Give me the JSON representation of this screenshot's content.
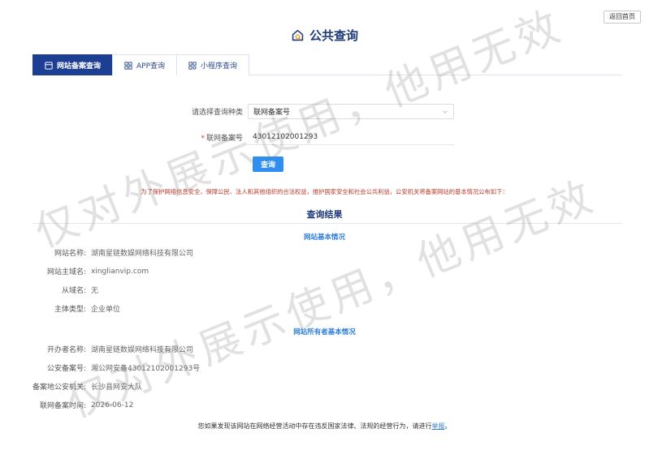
{
  "header": {
    "back_home": "返回首页",
    "title": "公共查询",
    "title_icon": "house-search-icon"
  },
  "tabs": [
    {
      "label": "网站备案查询",
      "icon": "globe-icon",
      "active": true
    },
    {
      "label": "APP查询",
      "icon": "app-grid-icon",
      "active": false
    },
    {
      "label": "小程序查询",
      "icon": "mini-program-icon",
      "active": false
    }
  ],
  "form": {
    "type_label": "请选择查询种类",
    "type_value": "联网备案号",
    "number_label": "联网备案号",
    "number_required_mark": "*",
    "number_value": "43012102001293",
    "query_button": "查询"
  },
  "notice": "为了保护网络信息安全，保障公民、法人和其他组织的合法权益，维护国家安全和社会公共利益，公安机关将备案网站的基本情况公布如下：",
  "result": {
    "title": "查询结果",
    "site_section_title": "网站基本情况",
    "site_rows": [
      {
        "label": "网站名称:",
        "value": "湖南星链数娱网络科技有限公司"
      },
      {
        "label": "网站主域名:",
        "value": "xinglianvip.com"
      },
      {
        "label": "从域名:",
        "value": "无"
      },
      {
        "label": "主体类型:",
        "value": "企业单位"
      }
    ],
    "owner_section_title": "网站所有者基本情况",
    "owner_rows": [
      {
        "label": "开办者名称:",
        "value": "湖南星链数娱网络科技有限公司"
      },
      {
        "label": "公安备案号:",
        "value": "湘公网安备43012102001293号"
      },
      {
        "label": "备案地公安机关:",
        "value": "长沙县网安大队"
      },
      {
        "label": "联网备案时间:",
        "value": "2026-06-12"
      }
    ]
  },
  "footer": {
    "text": "您如果发现该网站在网络经营活动中存在违反国家法律、法规的经营行为，请进行",
    "link": "举报",
    "end": "。"
  },
  "watermarks": [
    "仅对外展示使用，他用无效",
    "仅对外展示使用，他用无效"
  ],
  "colors": {
    "primary": "#1c3f94",
    "accent": "#2f8ef0",
    "notice": "#c0392b",
    "section": "#2f7fd6"
  }
}
